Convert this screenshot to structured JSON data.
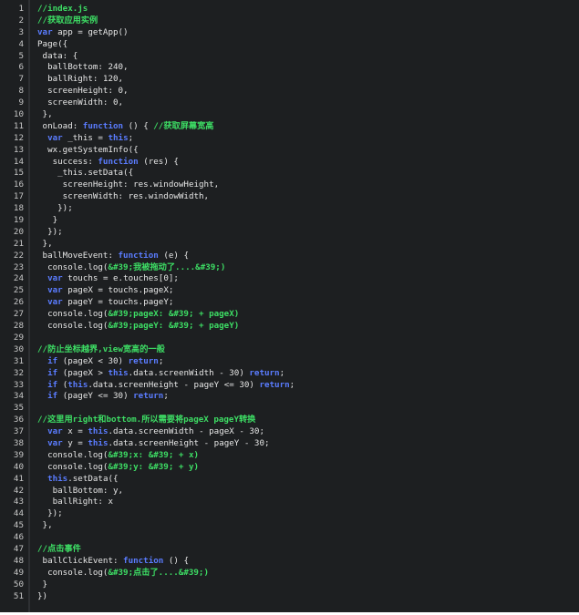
{
  "colors": {
    "background": "#1d1f21",
    "text": "#e6e6e6",
    "keyword": "#5a7cff",
    "comment": "#3ddc64",
    "line_number": "#c8c8c8"
  },
  "editor": {
    "lines": [
      {
        "n": "1",
        "t": [
          [
            "comment",
            "//index.js"
          ]
        ]
      },
      {
        "n": "2",
        "t": [
          [
            "comment",
            "//获取应用实例"
          ]
        ]
      },
      {
        "n": "3",
        "t": [
          [
            "kw",
            "var"
          ],
          [
            "plain",
            " app = getApp()"
          ]
        ]
      },
      {
        "n": "4",
        "t": [
          [
            "plain",
            "Page({"
          ]
        ]
      },
      {
        "n": "5",
        "t": [
          [
            "plain",
            " data: {"
          ]
        ]
      },
      {
        "n": "6",
        "t": [
          [
            "plain",
            "  ballBottom: 240,"
          ]
        ]
      },
      {
        "n": "7",
        "t": [
          [
            "plain",
            "  ballRight: 120,"
          ]
        ]
      },
      {
        "n": "8",
        "t": [
          [
            "plain",
            "  screenHeight: 0,"
          ]
        ]
      },
      {
        "n": "9",
        "t": [
          [
            "plain",
            "  screenWidth: 0,"
          ]
        ]
      },
      {
        "n": "10",
        "t": [
          [
            "plain",
            " },"
          ]
        ]
      },
      {
        "n": "11",
        "t": [
          [
            "plain",
            " onLoad: "
          ],
          [
            "kw",
            "function"
          ],
          [
            "plain",
            " () { "
          ],
          [
            "comment",
            "//获取屏幕宽高"
          ]
        ]
      },
      {
        "n": "12",
        "t": [
          [
            "plain",
            "  "
          ],
          [
            "kw",
            "var"
          ],
          [
            "plain",
            " _this = "
          ],
          [
            "kw",
            "this"
          ],
          [
            "plain",
            ";"
          ]
        ]
      },
      {
        "n": "13",
        "t": [
          [
            "plain",
            "  wx.getSystemInfo({"
          ]
        ]
      },
      {
        "n": "14",
        "t": [
          [
            "plain",
            "   success: "
          ],
          [
            "kw",
            "function"
          ],
          [
            "plain",
            " (res) {"
          ]
        ]
      },
      {
        "n": "15",
        "t": [
          [
            "plain",
            "    _this.setData({"
          ]
        ]
      },
      {
        "n": "16",
        "t": [
          [
            "plain",
            "     screenHeight: res.windowHeight,"
          ]
        ]
      },
      {
        "n": "17",
        "t": [
          [
            "plain",
            "     screenWidth: res.windowWidth,"
          ]
        ]
      },
      {
        "n": "18",
        "t": [
          [
            "plain",
            "    });"
          ]
        ]
      },
      {
        "n": "19",
        "t": [
          [
            "plain",
            "   }"
          ]
        ]
      },
      {
        "n": "20",
        "t": [
          [
            "plain",
            "  });"
          ]
        ]
      },
      {
        "n": "21",
        "t": [
          [
            "plain",
            " },"
          ]
        ]
      },
      {
        "n": "22",
        "t": [
          [
            "plain",
            " ballMoveEvent: "
          ],
          [
            "kw",
            "function"
          ],
          [
            "plain",
            " (e) {"
          ]
        ]
      },
      {
        "n": "23",
        "t": [
          [
            "plain",
            "  console.log("
          ],
          [
            "str",
            "&#39;我被拖动了....&#39;)"
          ]
        ]
      },
      {
        "n": "24",
        "t": [
          [
            "plain",
            "  "
          ],
          [
            "kw",
            "var"
          ],
          [
            "plain",
            " touchs = e.touches[0];"
          ]
        ]
      },
      {
        "n": "25",
        "t": [
          [
            "plain",
            "  "
          ],
          [
            "kw",
            "var"
          ],
          [
            "plain",
            " pageX = touchs.pageX;"
          ]
        ]
      },
      {
        "n": "26",
        "t": [
          [
            "plain",
            "  "
          ],
          [
            "kw",
            "var"
          ],
          [
            "plain",
            " pageY = touchs.pageY;"
          ]
        ]
      },
      {
        "n": "27",
        "t": [
          [
            "plain",
            "  console.log("
          ],
          [
            "str",
            "&#39;pageX: &#39; + pageX)"
          ]
        ]
      },
      {
        "n": "28",
        "t": [
          [
            "plain",
            "  console.log("
          ],
          [
            "str",
            "&#39;pageY: &#39; + pageY)"
          ]
        ]
      },
      {
        "n": "29",
        "t": [
          [
            "plain",
            ""
          ]
        ]
      },
      {
        "n": "30",
        "t": [
          [
            "comment",
            "//防止坐标越界,view宽高的一般"
          ]
        ]
      },
      {
        "n": "31",
        "t": [
          [
            "plain",
            "  "
          ],
          [
            "kw",
            "if"
          ],
          [
            "plain",
            " (pageX < 30) "
          ],
          [
            "kw",
            "return"
          ],
          [
            "plain",
            ";"
          ]
        ]
      },
      {
        "n": "32",
        "t": [
          [
            "plain",
            "  "
          ],
          [
            "kw",
            "if"
          ],
          [
            "plain",
            " (pageX > "
          ],
          [
            "kw",
            "this"
          ],
          [
            "plain",
            ".data.screenWidth - 30) "
          ],
          [
            "kw",
            "return"
          ],
          [
            "plain",
            ";"
          ]
        ]
      },
      {
        "n": "33",
        "t": [
          [
            "plain",
            "  "
          ],
          [
            "kw",
            "if"
          ],
          [
            "plain",
            " ("
          ],
          [
            "kw",
            "this"
          ],
          [
            "plain",
            ".data.screenHeight - pageY <= 30) "
          ],
          [
            "kw",
            "return"
          ],
          [
            "plain",
            ";"
          ]
        ]
      },
      {
        "n": "34",
        "t": [
          [
            "plain",
            "  "
          ],
          [
            "kw",
            "if"
          ],
          [
            "plain",
            " (pageY <= 30) "
          ],
          [
            "kw",
            "return"
          ],
          [
            "plain",
            ";"
          ]
        ]
      },
      {
        "n": "35",
        "t": [
          [
            "plain",
            ""
          ]
        ]
      },
      {
        "n": "36",
        "t": [
          [
            "comment",
            "//这里用right和bottom.所以需要将pageX pageY转换"
          ]
        ]
      },
      {
        "n": "37",
        "t": [
          [
            "plain",
            "  "
          ],
          [
            "kw",
            "var"
          ],
          [
            "plain",
            " x = "
          ],
          [
            "kw",
            "this"
          ],
          [
            "plain",
            ".data.screenWidth - pageX - 30;"
          ]
        ]
      },
      {
        "n": "38",
        "t": [
          [
            "plain",
            "  "
          ],
          [
            "kw",
            "var"
          ],
          [
            "plain",
            " y = "
          ],
          [
            "kw",
            "this"
          ],
          [
            "plain",
            ".data.screenHeight - pageY - 30;"
          ]
        ]
      },
      {
        "n": "39",
        "t": [
          [
            "plain",
            "  console.log("
          ],
          [
            "str",
            "&#39;x: &#39; + x)"
          ]
        ]
      },
      {
        "n": "40",
        "t": [
          [
            "plain",
            "  console.log("
          ],
          [
            "str",
            "&#39;y: &#39; + y)"
          ]
        ]
      },
      {
        "n": "41",
        "t": [
          [
            "plain",
            "  "
          ],
          [
            "kw",
            "this"
          ],
          [
            "plain",
            ".setData({"
          ]
        ]
      },
      {
        "n": "42",
        "t": [
          [
            "plain",
            "   ballBottom: y,"
          ]
        ]
      },
      {
        "n": "43",
        "t": [
          [
            "plain",
            "   ballRight: x"
          ]
        ]
      },
      {
        "n": "44",
        "t": [
          [
            "plain",
            "  });"
          ]
        ]
      },
      {
        "n": "45",
        "t": [
          [
            "plain",
            " },"
          ]
        ]
      },
      {
        "n": "46",
        "t": [
          [
            "plain",
            ""
          ]
        ]
      },
      {
        "n": "47",
        "t": [
          [
            "comment",
            "//点击事件"
          ]
        ]
      },
      {
        "n": "48",
        "t": [
          [
            "plain",
            " ballClickEvent: "
          ],
          [
            "kw",
            "function"
          ],
          [
            "plain",
            " () {"
          ]
        ]
      },
      {
        "n": "49",
        "t": [
          [
            "plain",
            "  console.log("
          ],
          [
            "str",
            "&#39;点击了....&#39;)"
          ]
        ]
      },
      {
        "n": "50",
        "t": [
          [
            "plain",
            " }"
          ]
        ]
      },
      {
        "n": "51",
        "t": [
          [
            "plain",
            "})"
          ]
        ]
      }
    ]
  }
}
